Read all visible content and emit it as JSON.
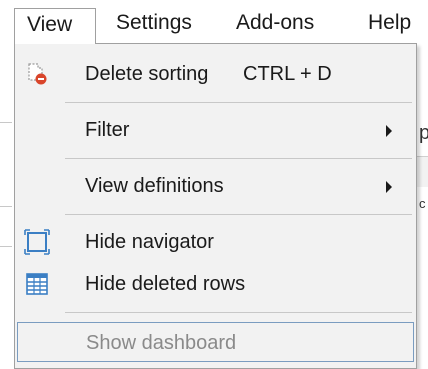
{
  "menubar": {
    "items": [
      {
        "label": "View"
      },
      {
        "label": "Settings"
      },
      {
        "label": "Add-ons"
      },
      {
        "label": "Help"
      }
    ]
  },
  "dropdown": {
    "items": [
      {
        "label": "Delete sorting",
        "shortcut": "CTRL + D",
        "icon": "delete-sorting-icon"
      },
      {
        "label": "Filter",
        "submenu": true
      },
      {
        "label": "View definitions",
        "submenu": true
      },
      {
        "label": "Hide navigator",
        "icon": "navigator-frame-icon"
      },
      {
        "label": "Hide deleted rows",
        "icon": "table-rows-icon"
      },
      {
        "label": "Show dashboard",
        "disabled": true,
        "focused": true
      }
    ]
  },
  "background": {
    "fragment_p": "p",
    "fragment_c": "c"
  },
  "colors": {
    "menu_bg": "#f2f2f2",
    "border": "#a0a0a0",
    "focus_border": "#7a9cc0",
    "disabled_text": "#8a8a8a",
    "icon_blue": "#3b7fc4",
    "icon_red": "#d9452b"
  }
}
